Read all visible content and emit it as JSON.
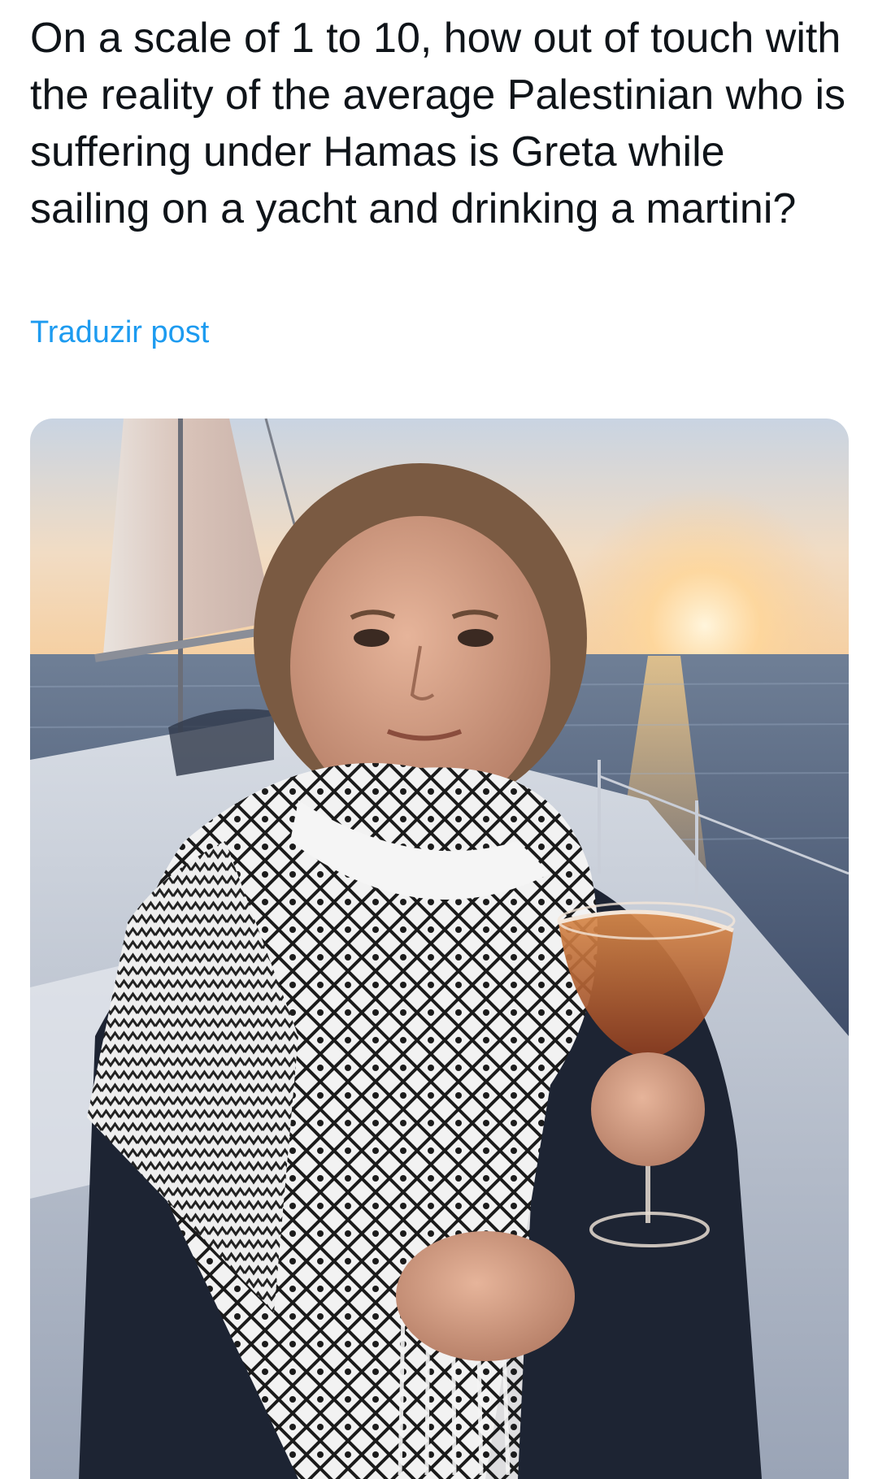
{
  "post": {
    "text": "On a scale of 1 to 10, how out of touch with the reality of the average Palestinian who is suffering under Hamas is Greta while sailing on a yacht and drinking a martini?",
    "translate_label": "Traduzir post"
  },
  "colors": {
    "text": "#0f1419",
    "link": "#1d9bf0",
    "background": "#ffffff"
  }
}
